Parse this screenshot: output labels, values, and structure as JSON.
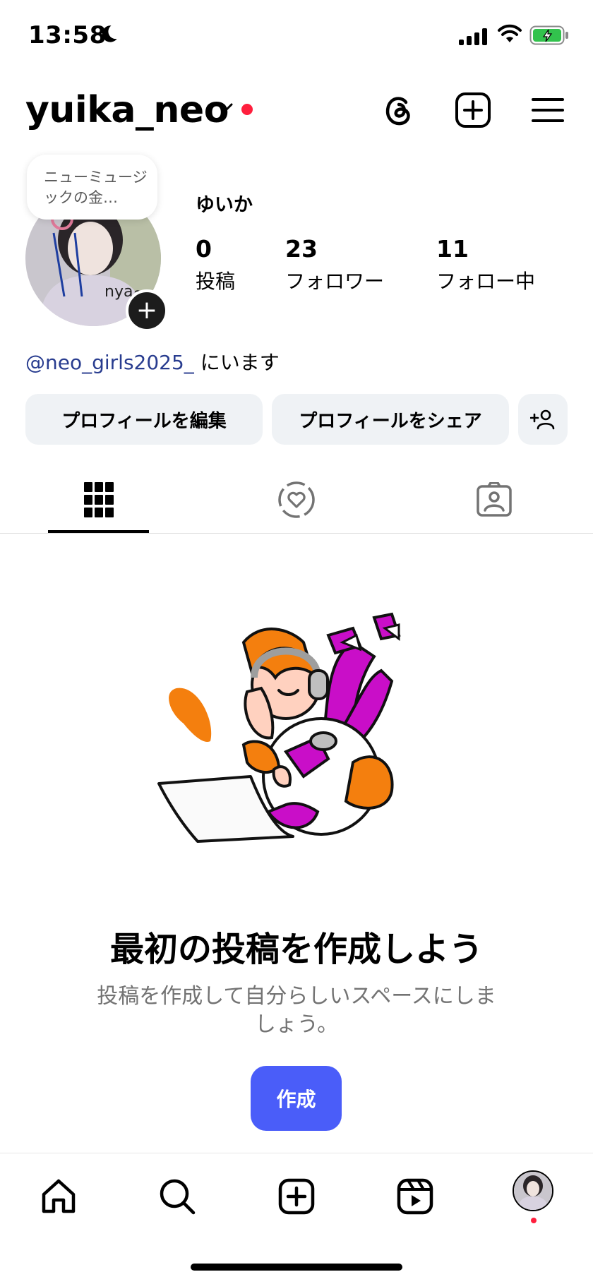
{
  "status_bar": {
    "time": "13:58"
  },
  "header": {
    "username": "yuika_neo"
  },
  "profile": {
    "note_text": "ニューミュージックの金…",
    "display_name": "ゆいか",
    "stats": [
      {
        "number": "0",
        "label": "投稿"
      },
      {
        "number": "23",
        "label": "フォロワー"
      },
      {
        "number": "11",
        "label": "フォロー中"
      }
    ],
    "location_mention": "@neo_girls2025_",
    "location_suffix": " にいます"
  },
  "buttons": {
    "edit_profile": "プロフィールを編集",
    "share_profile": "プロフィールをシェア"
  },
  "empty_state": {
    "title": "最初の投稿を作成しよう",
    "subtitle": "投稿を作成して自分らしいスペースにしましょう。",
    "create_button": "作成"
  },
  "colors": {
    "accent_blue": "#4a5df9",
    "mention_blue": "#283c8f",
    "notification_red": "#ff1f3d",
    "button_gray": "#eff2f5"
  }
}
